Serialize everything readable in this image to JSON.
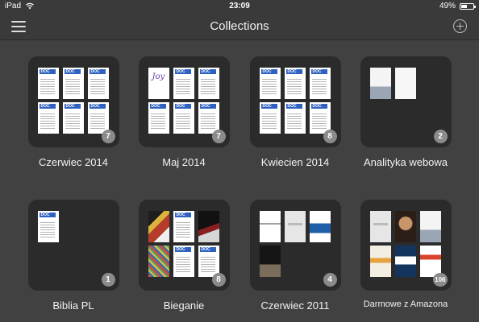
{
  "status_bar": {
    "device": "iPad",
    "time": "23:09",
    "battery_text": "49%",
    "battery_level": 0.49
  },
  "nav": {
    "title": "Collections",
    "menu_icon": "hamburger-icon",
    "add_icon": "plus-circle-icon"
  },
  "collections": [
    {
      "label": "Czerwiec 2014",
      "count": "7",
      "thumbs": [
        "doc",
        "doc",
        "doc",
        "doc",
        "doc",
        "doc"
      ]
    },
    {
      "label": "Maj 2014",
      "count": "7",
      "thumbs": [
        "jo",
        "doc",
        "doc",
        "doc",
        "doc",
        "doc"
      ]
    },
    {
      "label": "Kwiecien 2014",
      "count": "8",
      "thumbs": [
        "doc",
        "doc",
        "doc",
        "doc",
        "doc",
        "doc"
      ]
    },
    {
      "label": "Analityka webowa",
      "count": "2",
      "thumbs": [
        "lamp",
        "white"
      ]
    },
    {
      "label": "Biblia PL",
      "count": "1",
      "thumbs": [
        "doc"
      ]
    },
    {
      "label": "Bieganie",
      "count": "8",
      "thumbs": [
        "run1",
        "doc",
        "run2",
        "crowd",
        "doc",
        "doc"
      ]
    },
    {
      "label": "Czerwiec 2011",
      "count": "4",
      "thumbs": [
        "sign",
        "light",
        "blue",
        "war"
      ]
    },
    {
      "label": "Darmowe z Amazona",
      "count": "106",
      "thumbs": [
        "light",
        "face",
        "lamp",
        "yel",
        "navy",
        "red"
      ]
    }
  ],
  "doc_label": "DOC"
}
